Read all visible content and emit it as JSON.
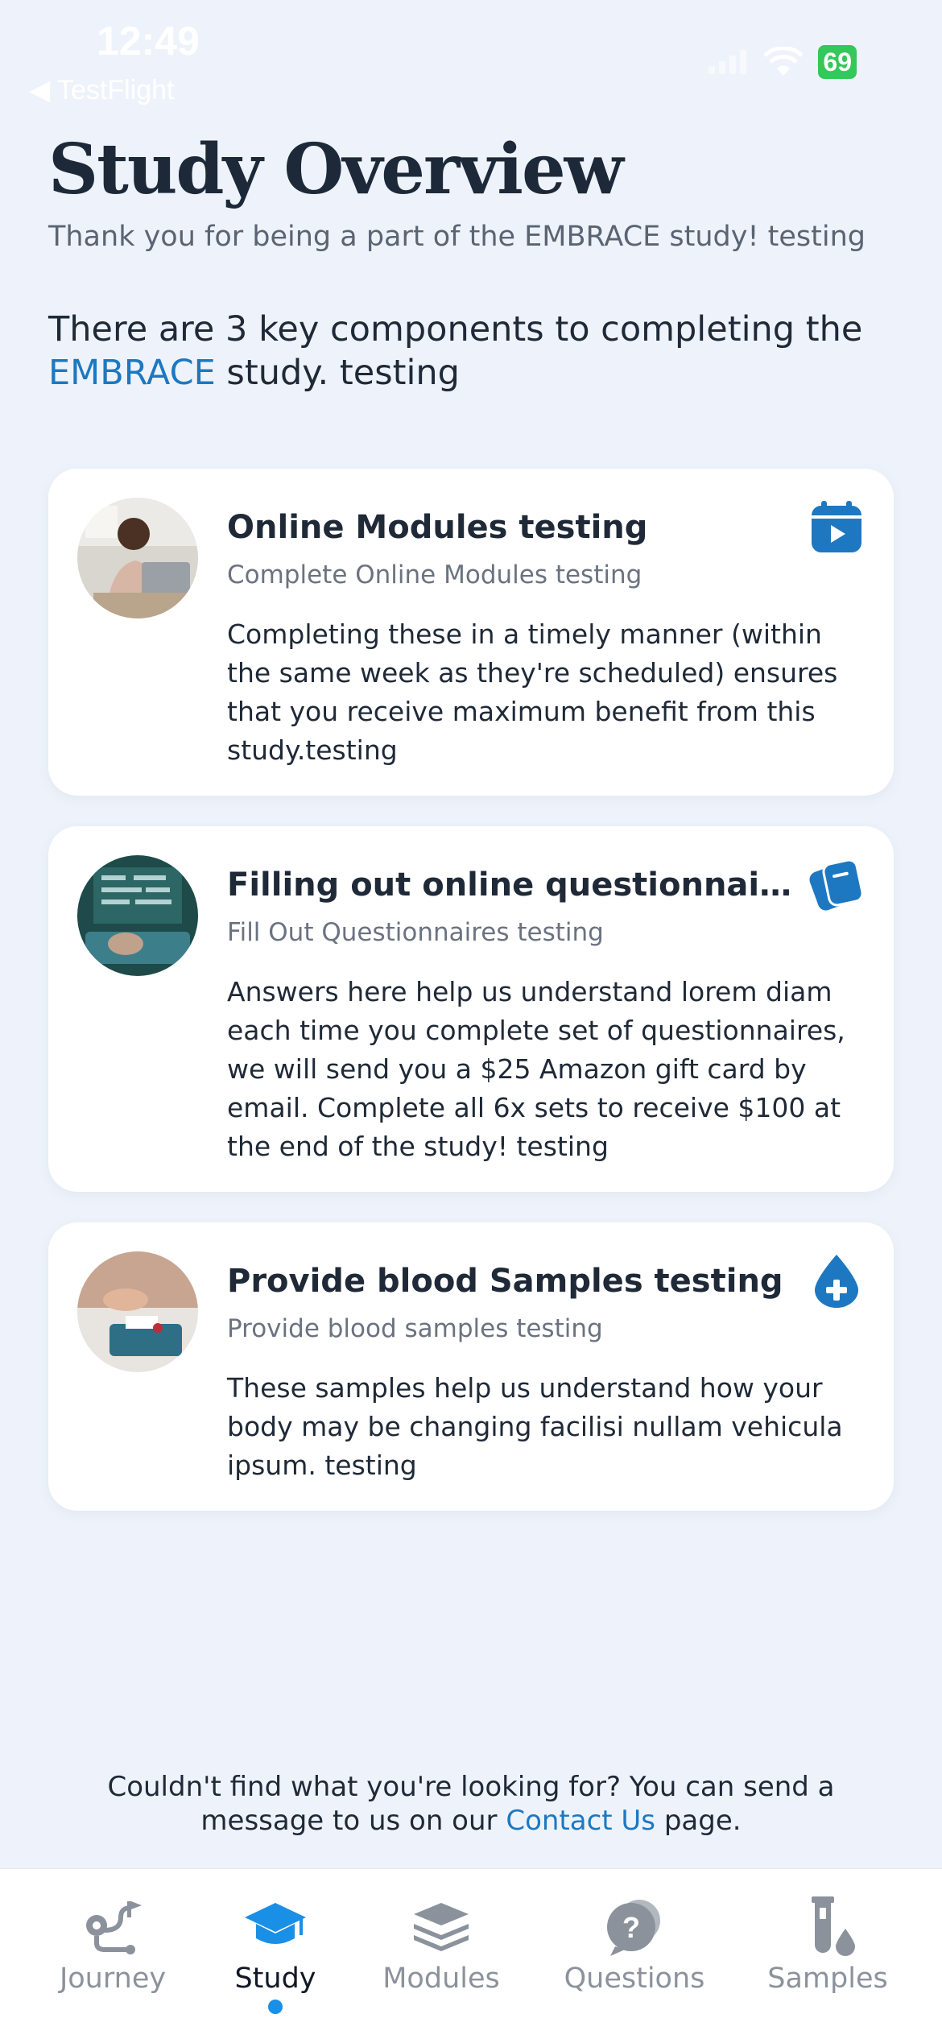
{
  "status_bar": {
    "time": "12:49",
    "back_label": "◀ TestFlight",
    "battery": "69"
  },
  "header": {
    "title": "Study Overview",
    "subtitle": "Thank you for being a part of the EMBRACE study! testing"
  },
  "intro": {
    "text_before": "There are 3 key components to completing the",
    "accent": "EMBRACE",
    "text_after": " study.  testing"
  },
  "cards": [
    {
      "title": "Online Modules testing",
      "subtitle": "Complete Online Modules testing",
      "description": "Completing these in a timely manner (within the same week as they're scheduled) ensures that you receive maximum benefit from this study.testing",
      "icon": "video-calendar-icon"
    },
    {
      "title": "Filling out online questionnaires testing",
      "subtitle": "Fill Out Questionnaires testing",
      "description": "Answers here help us understand lorem diam each time you complete set of questionnaires, we will send you a $25 Amazon gift card by email. Complete all 6x sets to receive $100 at the end of the study!  testing",
      "icon": "questionnaire-cards-icon"
    },
    {
      "title": "Provide blood Samples testing",
      "subtitle": "Provide blood samples testing",
      "description": "These samples help us understand how your body may be changing facilisi nullam vehicula ipsum. testing",
      "icon": "blood-drop-plus-icon"
    }
  ],
  "contact": {
    "text_before": "Couldn't find what you're looking for? You can send a message to us on our ",
    "link": "Contact Us",
    "text_after": " page."
  },
  "tabs": [
    {
      "label": "Journey",
      "icon": "route-icon",
      "active": false
    },
    {
      "label": "Study",
      "icon": "graduation-cap-icon",
      "active": true
    },
    {
      "label": "Modules",
      "icon": "layers-icon",
      "active": false
    },
    {
      "label": "Questions",
      "icon": "question-bubble-icon",
      "active": false
    },
    {
      "label": "Samples",
      "icon": "test-tube-icon",
      "active": false
    }
  ],
  "colors": {
    "accent": "#1d78c1",
    "background": "#eef3fb",
    "active_dot": "#1a8fe6",
    "battery": "#34c759"
  }
}
